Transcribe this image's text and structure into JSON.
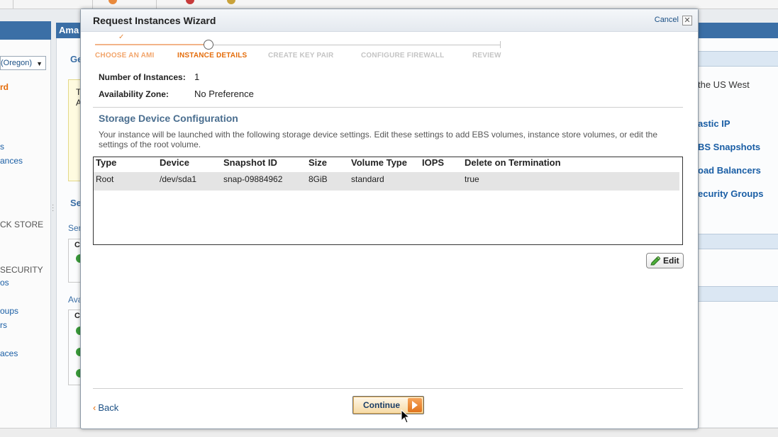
{
  "background": {
    "region_label": "(Oregon)",
    "sidebar_links": [
      "rd",
      "s",
      "ances",
      "CK STORE",
      "SECURITY",
      "os",
      "oups",
      "rs",
      "aces"
    ],
    "main_header": "Ama",
    "main_fragments": [
      "Ge",
      "T",
      "A",
      "Se",
      "Ser",
      "C",
      "Ava",
      "C"
    ],
    "right_text": "the US West",
    "right_links": [
      "astic IP",
      "BS Snapshots",
      "oad Balancers",
      "ecurity Groups"
    ]
  },
  "wizard": {
    "title": "Request Instances Wizard",
    "cancel_label": "Cancel",
    "close_glyph": "✕",
    "steps": [
      {
        "label": "CHOOSE AN AMI",
        "state": "done"
      },
      {
        "label": "INSTANCE DETAILS",
        "state": "active"
      },
      {
        "label": "CREATE KEY PAIR",
        "state": "todo"
      },
      {
        "label": "CONFIGURE FIREWALL",
        "state": "todo"
      },
      {
        "label": "REVIEW",
        "state": "todo"
      }
    ],
    "done_check": "✓",
    "fields": {
      "instances_label": "Number of Instances:",
      "instances_value": "1",
      "zone_label": "Availability Zone:",
      "zone_value": "No Preference"
    },
    "storage": {
      "title": "Storage Device Configuration",
      "description": "Your instance will be launched with the following storage device settings. Edit these settings to add EBS volumes, instance store volumes, or edit the settings of the root volume.",
      "columns": [
        "Type",
        "Device",
        "Snapshot ID",
        "Size",
        "Volume Type",
        "IOPS",
        "Delete on Termination"
      ],
      "rows": [
        [
          "Root",
          "/dev/sda1",
          "snap-09884962",
          "8GiB",
          "standard",
          "",
          "true"
        ]
      ]
    },
    "edit_label": "Edit",
    "back_label": "Back",
    "back_chevron": "‹",
    "continue_label": "Continue"
  },
  "colors": {
    "accent_orange": "#e46c0a",
    "link_blue": "#1a4f84",
    "header_blue": "#3b6fa6"
  },
  "icons": {
    "close": "close-icon",
    "edit": "pencil-icon",
    "continue": "arrow-right-icon",
    "cursor": "mouse-pointer-icon"
  }
}
